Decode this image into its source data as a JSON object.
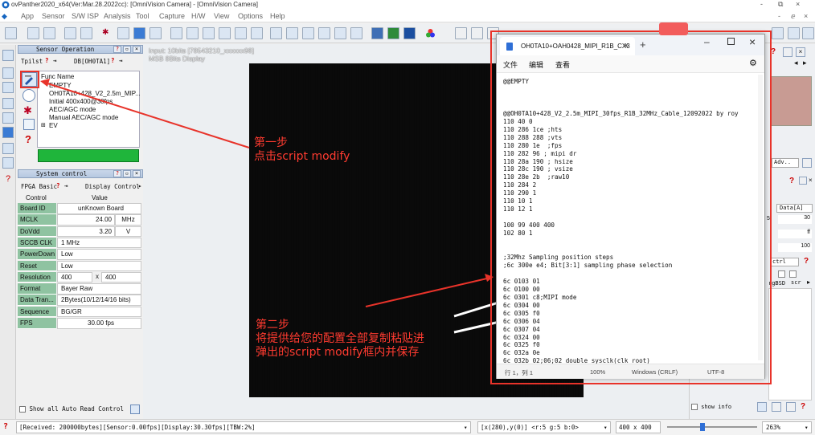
{
  "app": {
    "title": "ovPanther2020_x64(Ver:Mar.28.2022cc): [OmniVision Camera] - [OmniVision Camera]",
    "window_controls": [
      "-",
      "⧉",
      "×"
    ],
    "inner_controls": [
      "-",
      "ⅇ",
      "×"
    ]
  },
  "menu": [
    "App",
    "Sensor",
    "S/W ISP",
    "Analysis",
    "Tool",
    "Capture",
    "H/W",
    "View",
    "Options",
    "Help"
  ],
  "sensor_operation": {
    "title": "Sensor Operation",
    "tabs": [
      "Tpilst",
      "DB[OH0TA1]"
    ],
    "tree_header": "Func Name",
    "tree_items": [
      "EMPTY",
      "OH0TA10+428_V2_2.5m_MIP...",
      "Initial 400x400@30fps",
      "AEC/AGC mode",
      "Manual AEC/AGC mode",
      "EV"
    ]
  },
  "system_control": {
    "title": "System control",
    "tabs": [
      "FPGA Basic",
      "Display Control"
    ],
    "col_control": "Control",
    "col_value": "Value",
    "rows": [
      {
        "label": "Board ID",
        "value": "unKnown Board"
      },
      {
        "label": "MCLK",
        "value": "24.00",
        "unit": "MHz"
      },
      {
        "label": "DoVdd",
        "value": "3.20",
        "unit": "V"
      },
      {
        "label": "SCCB CLK",
        "value": "1 MHz"
      },
      {
        "label": "PowerDown",
        "value": "Low"
      },
      {
        "label": "Reset",
        "value": "Low"
      },
      {
        "label": "Resolution",
        "value": "400",
        "value2": "400",
        "sep": "x"
      },
      {
        "label": "Format",
        "value": "Bayer Raw"
      },
      {
        "label": "Data Tran...",
        "value": "2Bytes(10/12/14/16 bits)"
      },
      {
        "label": "Sequence",
        "value": "BG/GR"
      },
      {
        "label": "FPS",
        "value": "30.00 fps"
      }
    ],
    "show_all": "Show all Auto Read Control"
  },
  "viewer": {
    "input_line1": "Input: 10bits [78543210_xxxxxx98]",
    "input_line2": "MSB 8Bits Display"
  },
  "right_panel": {
    "adv": "Adv..",
    "data_select": "Data[A]",
    "val1": "30",
    "val2": "ff",
    "val3": "100",
    "ctrl": "ctrl",
    "scr": "scr",
    "rgb_label": "rgBSD",
    "left_digit": "5",
    "show_info": "show info"
  },
  "notepad": {
    "tab_title": "OH0TA10+OAH0428_MIPI_R1B_CX3",
    "menu": [
      "文件",
      "编辑",
      "查看"
    ],
    "content": "@@EMPTY\n\n\n\n@@OH0TA10+428_V2_2.5m_MIPI_30fps_R1B_32MHz_Cable_12092022 by roy\n110 40 0\n110 286 1ce ;hts\n110 288 288 ;vts\n110 280 1e  ;fps\n110 282 96 ; mipi dr\n110 28a 190 ; hsize\n110 28c 190 ; vsize\n110 28e 2b  ;raw10\n110 284 2\n110 290 1\n110 10 1\n110 12 1\n\n100 99 400 400\n102 80 1\n\n\n;32Mhz Sampling position steps\n;6c 300e e4; Bit[3:1] sampling phase selection\n\n6c 0103 01\n6c 0100 00\n6c 0301 c8;MIPI mode\n6c 0304 00\n6c 0305 f0\n6c 0306 04\n6c 0307 04\n6c 0324 00\n6c 0325 f0\n6c 032a 0e\n6c 032b 02;06;02 double sysclk(clk root)",
    "status": {
      "pos": "行 1，列 1",
      "zoom": "100%",
      "eol": "Windows (CRLF)",
      "enc": "UTF-8"
    }
  },
  "annotations": {
    "step1_title": "第一步",
    "step1_text": "点击script modify",
    "step2_title": "第二步",
    "step2_line1": "将提供给您的配置全部复制粘贴进",
    "step2_line2": "弹出的script modify框内并保存",
    "color": "#ff3b30"
  },
  "statusbar": {
    "received": "[Received: 200000bytes][Sensor:0.00fps][Display:30.30fps][TBW:2%]",
    "coords": "[x(280),y(0)] <r:5 g:5 b:0>",
    "resolution": "400 x 400",
    "zoom": "263%"
  }
}
